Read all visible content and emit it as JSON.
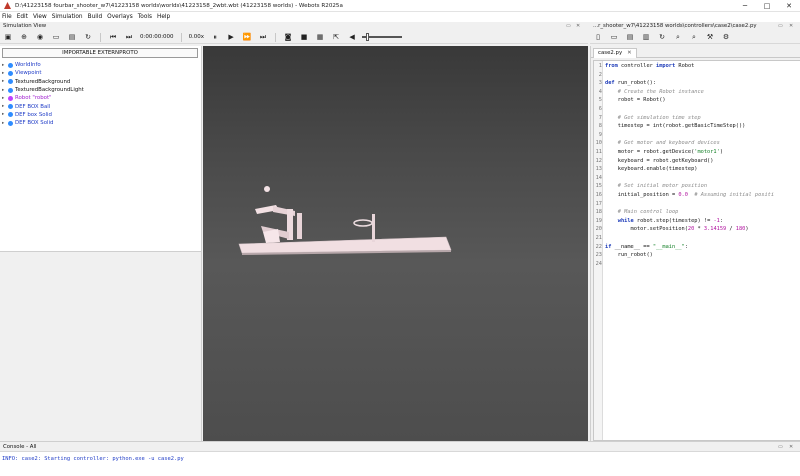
{
  "window": {
    "title": "D:\\41223158 fourbar_shooter_w7\\41223158 worlds\\worlds\\41223158_2wbt.wbt (41223158 worlds) - Webots R2025a",
    "controls": [
      "─",
      "□",
      "✕"
    ]
  },
  "menu": [
    "File",
    "Edit",
    "View",
    "Simulation",
    "Build",
    "Overlays",
    "Tools",
    "Help"
  ],
  "simulation_view": {
    "title": "Simulation View",
    "controls": [
      "▭",
      "✕"
    ]
  },
  "toolbar": {
    "time": "0:00:00:000",
    "speed": "0.00x",
    "slider_level": 0.1
  },
  "scene_tree": {
    "extern_button": "IMPORTABLE EXTERNPROTO",
    "items": [
      {
        "label": "WorldInfo",
        "color": "#2a5fd8",
        "text_color": "#1f3cc7",
        "dot": "#2f8cff"
      },
      {
        "label": "Viewpoint",
        "color": "#2a5fd8",
        "text_color": "#1f3cc7",
        "dot": "#2f8cff"
      },
      {
        "label": "TexturedBackground",
        "color": "#111",
        "text_color": "#111111",
        "dot": "#2f8cff"
      },
      {
        "label": "TexturedBackgroundLight",
        "color": "#111",
        "text_color": "#111111",
        "dot": "#2f8cff"
      },
      {
        "label": "Robot \"robot\"",
        "color": "#8c2fc9",
        "text_color": "#a020d0",
        "dot": "#c040ff"
      },
      {
        "label": "DEF BOX Ball",
        "color": "#8c2fc9",
        "text_color": "#1f3cc7",
        "dot": "#2f8cff"
      },
      {
        "label": "DEF box Solid",
        "color": "#8c2fc9",
        "text_color": "#1f3cc7",
        "dot": "#2f8cff"
      },
      {
        "label": "DEF BOX Solid",
        "color": "#8c2fc9",
        "text_color": "#1f3cc7",
        "dot": "#2f8cff"
      }
    ]
  },
  "editor": {
    "title": "...r_shooter_w7\\41223158 worlds\\controllers\\case2\\case2.py",
    "controls": [
      "▭",
      "✕"
    ],
    "tab": "case2.py",
    "lines": [
      "from controller import Robot",
      "",
      "def run_robot():",
      "    # Create the Robot instance",
      "    robot = Robot()",
      "",
      "    # Get simulation time step",
      "    timestep = int(robot.getBasicTimeStep())",
      "",
      "    # Get motor and keyboard devices",
      "    motor = robot.getDevice('motor1')",
      "    keyboard = robot.getKeyboard()",
      "    keyboard.enable(timestep)",
      "",
      "    # Set initial motor position",
      "    initial_position = 0.0  # Assuming initial positi",
      "",
      "    # Main control loop",
      "    while robot.step(timestep) != -1:",
      "        motor.setPosition(20 * 3.14159 / 180)",
      "",
      "if __name__ == \"__main__\":",
      "    run_robot()",
      ""
    ]
  },
  "console": {
    "title": "Console - All",
    "controls": [
      "▭",
      "✕"
    ],
    "message": "INFO: case2: Starting controller: python.exe -u case2.py"
  }
}
